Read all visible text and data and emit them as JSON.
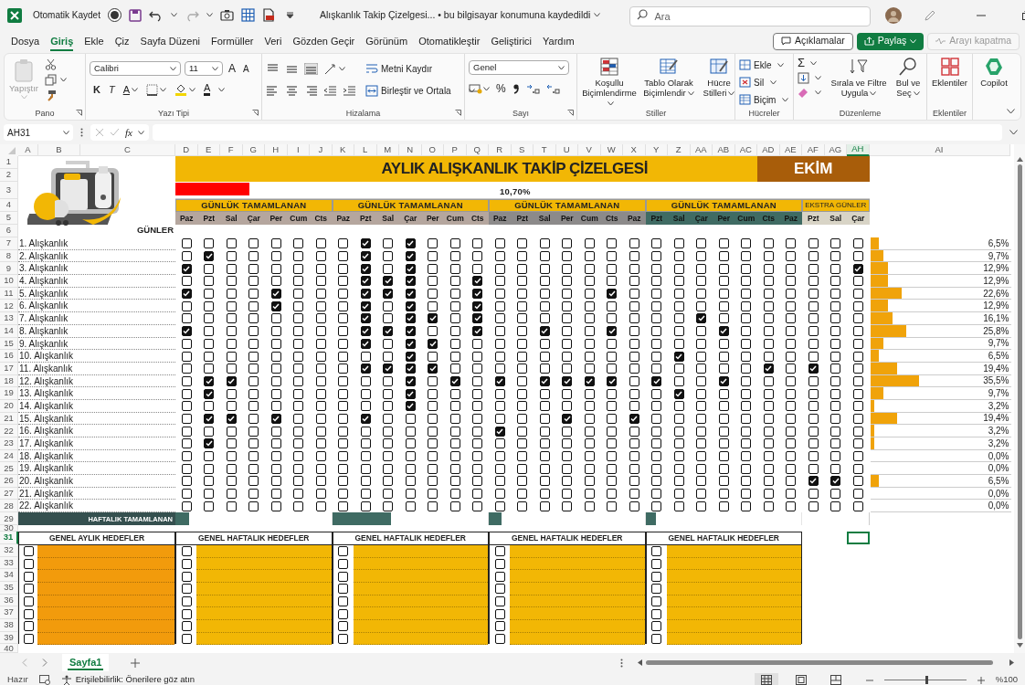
{
  "title_bar": {
    "autosave_label": "Otomatik Kaydet",
    "autosave_on": false,
    "document_title": "Alışkanlık Takip Çizelgesi...  •  bu bilgisayar konumuna kaydedildi",
    "search_placeholder": "Ara"
  },
  "menu_tabs": [
    {
      "label": "Dosya",
      "selected": false
    },
    {
      "label": "Giriş",
      "selected": true
    },
    {
      "label": "Ekle",
      "selected": false
    },
    {
      "label": "Çiz",
      "selected": false
    },
    {
      "label": "Sayfa Düzeni",
      "selected": false
    },
    {
      "label": "Formüller",
      "selected": false
    },
    {
      "label": "Veri",
      "selected": false
    },
    {
      "label": "Gözden Geçir",
      "selected": false
    },
    {
      "label": "Görünüm",
      "selected": false
    },
    {
      "label": "Otomatikleştir",
      "selected": false
    },
    {
      "label": "Geliştirici",
      "selected": false
    },
    {
      "label": "Yardım",
      "selected": false
    }
  ],
  "menu_buttons": [
    {
      "kind": "comments",
      "label": "Açıklamalar"
    },
    {
      "kind": "share",
      "label": "Paylaş"
    },
    {
      "kind": "call",
      "label": "Arayı kapatma",
      "disabled": true
    }
  ],
  "ribbon": [
    {
      "kind": "clipboard",
      "label": "Pano",
      "buttons": [
        "Yapıştır"
      ]
    },
    {
      "kind": "font",
      "label": "Yazı Tipi",
      "font": "Calibri",
      "size": "11",
      "grow": "A",
      "shrink": "A",
      "bold": "K",
      "italic": "T",
      "underline": "A",
      "color_letter": "A"
    },
    {
      "kind": "alignment",
      "label": "Hizalama",
      "buttons": [
        "Metni Kaydır",
        "Birleştir ve Ortala"
      ]
    },
    {
      "kind": "number",
      "label": "Sayı",
      "format": "Genel",
      "percent": "%"
    },
    {
      "kind": "styles",
      "label": "Stiller",
      "buttons": [
        "Koşullu Biçimlendirme",
        "Tablo Olarak Biçimlendir",
        "Hücre Stilleri"
      ]
    },
    {
      "kind": "cells",
      "label": "Hücreler",
      "buttons": [
        "Ekle",
        "Sil",
        "Biçim"
      ]
    },
    {
      "kind": "editing",
      "label": "Düzenleme",
      "sum": "Σ",
      "buttons": [
        "Sırala ve Filtre Uygula",
        "Bul ve Seç"
      ]
    },
    {
      "kind": "addins",
      "label": "Eklentiler",
      "buttons": [
        "Eklentiler"
      ]
    },
    {
      "kind": "copilot",
      "buttons": [
        "Copilot"
      ]
    }
  ],
  "formula_bar": {
    "name_box": "AH31",
    "fx": "fx"
  },
  "column_headers": [
    {
      "label": "A",
      "selected": false
    },
    {
      "label": "B",
      "selected": false
    },
    {
      "label": "C",
      "selected": false
    },
    {
      "label": "D",
      "selected": false
    },
    {
      "label": "E",
      "selected": false
    },
    {
      "label": "F",
      "selected": false
    },
    {
      "label": "G",
      "selected": false
    },
    {
      "label": "H",
      "selected": false
    },
    {
      "label": "I",
      "selected": false
    },
    {
      "label": "J",
      "selected": false
    },
    {
      "label": "K",
      "selected": false
    },
    {
      "label": "L",
      "selected": false
    },
    {
      "label": "M",
      "selected": false
    },
    {
      "label": "N",
      "selected": false
    },
    {
      "label": "O",
      "selected": false
    },
    {
      "label": "P",
      "selected": false
    },
    {
      "label": "Q",
      "selected": false
    },
    {
      "label": "R",
      "selected": false
    },
    {
      "label": "S",
      "selected": false
    },
    {
      "label": "T",
      "selected": false
    },
    {
      "label": "U",
      "selected": false
    },
    {
      "label": "V",
      "selected": false
    },
    {
      "label": "W",
      "selected": false
    },
    {
      "label": "X",
      "selected": false
    },
    {
      "label": "Y",
      "selected": false
    },
    {
      "label": "Z",
      "selected": false
    },
    {
      "label": "AA",
      "selected": false
    },
    {
      "label": "AB",
      "selected": false
    },
    {
      "label": "AC",
      "selected": false
    },
    {
      "label": "AD",
      "selected": false
    },
    {
      "label": "AE",
      "selected": false
    },
    {
      "label": "AF",
      "selected": false
    },
    {
      "label": "AG",
      "selected": false
    },
    {
      "label": "AH",
      "selected": true
    },
    {
      "label": "AI",
      "selected": false
    }
  ],
  "row_headers": [
    {
      "label": "1",
      "selected": false
    },
    {
      "label": "2",
      "selected": false
    },
    {
      "label": "3",
      "selected": false
    },
    {
      "label": "4",
      "selected": false
    },
    {
      "label": "5",
      "selected": false
    },
    {
      "label": "6",
      "selected": false
    },
    {
      "label": "7",
      "selected": false
    },
    {
      "label": "8",
      "selected": false
    },
    {
      "label": "9",
      "selected": false
    },
    {
      "label": "10",
      "selected": false
    },
    {
      "label": "11",
      "selected": false
    },
    {
      "label": "12",
      "selected": false
    },
    {
      "label": "13",
      "selected": false
    },
    {
      "label": "14",
      "selected": false
    },
    {
      "label": "15",
      "selected": false
    },
    {
      "label": "16",
      "selected": false
    },
    {
      "label": "17",
      "selected": false
    },
    {
      "label": "18",
      "selected": false
    },
    {
      "label": "19",
      "selected": false
    },
    {
      "label": "20",
      "selected": false
    },
    {
      "label": "21",
      "selected": false
    },
    {
      "label": "22",
      "selected": false
    },
    {
      "label": "23",
      "selected": false
    },
    {
      "label": "24",
      "selected": false
    },
    {
      "label": "25",
      "selected": false
    },
    {
      "label": "26",
      "selected": false
    },
    {
      "label": "27",
      "selected": false
    },
    {
      "label": "28",
      "selected": false
    },
    {
      "label": "29",
      "selected": false
    },
    {
      "label": "30",
      "selected": false
    },
    {
      "label": "31",
      "selected": true
    },
    {
      "label": "32",
      "selected": false
    },
    {
      "label": "33",
      "selected": false
    },
    {
      "label": "34",
      "selected": false
    },
    {
      "label": "35",
      "selected": false
    },
    {
      "label": "36",
      "selected": false
    },
    {
      "label": "37",
      "selected": false
    },
    {
      "label": "38",
      "selected": false
    },
    {
      "label": "39",
      "selected": false
    },
    {
      "label": "40",
      "selected": false
    }
  ],
  "tracker": {
    "title": "AYLIK ALIŞKANLIK TAKİP ÇİZELGESİ",
    "month": "EKİM",
    "progress": {
      "level": 0.107,
      "reading": "10,70%"
    },
    "days_label": "GÜNLER",
    "weekly_label": "HAFTALIK TAMAMLANAN",
    "weeks": [
      {
        "label": "GÜNLÜK TAMAMLANAN",
        "color": "#b5a69e",
        "days": [
          "Paz",
          "Pzt",
          "Sal",
          "Çar",
          "Per",
          "Cum",
          "Cts"
        ],
        "level": 0.09
      },
      {
        "label": "GÜNLÜK TAMAMLANAN",
        "color": "#b5a69e",
        "days": [
          "Paz",
          "Pzt",
          "Sal",
          "Çar",
          "Per",
          "Cum",
          "Cts"
        ],
        "level": 0.38
      },
      {
        "label": "GÜNLÜK TAMAMLANAN",
        "color": "#8c8a8a",
        "days": [
          "Paz",
          "Pzt",
          "Sal",
          "Per",
          "Cum",
          "Cts",
          "Paz"
        ],
        "level": 0.08
      },
      {
        "label": "GÜNLÜK TAMAMLANAN",
        "color": "#3f6b63",
        "days": [
          "Pzt",
          "Sal",
          "Çar",
          "Per",
          "Cum",
          "Cts",
          "Paz"
        ],
        "level": 0.07
      },
      {
        "label": "EKSTRA GÜNLER",
        "color": "#d8d4c6",
        "days": [
          "Pzt",
          "Sal",
          "Çar"
        ]
      }
    ],
    "habits": [
      {
        "name": "1. Alışkanlık",
        "level": 0.065,
        "reading": "6,5%",
        "checks": [
          [
            false,
            false,
            false,
            false,
            false,
            false,
            false
          ],
          [
            false,
            true,
            false,
            true,
            false,
            false,
            false
          ],
          [
            false,
            false,
            false,
            false,
            false,
            false,
            false
          ],
          [
            false,
            false,
            false,
            false,
            false,
            false,
            false
          ],
          [
            false,
            false,
            false
          ]
        ]
      },
      {
        "name": "2. Alışkanlık",
        "level": 0.097,
        "reading": "9,7%",
        "checks": [
          [
            false,
            true,
            false,
            false,
            false,
            false,
            false
          ],
          [
            false,
            true,
            false,
            true,
            false,
            false,
            false
          ],
          [
            false,
            false,
            false,
            false,
            false,
            false,
            false
          ],
          [
            false,
            false,
            false,
            false,
            false,
            false,
            false
          ],
          [
            false,
            false,
            false
          ]
        ]
      },
      {
        "name": "3. Alışkanlık",
        "level": 0.129,
        "reading": "12,9%",
        "checks": [
          [
            true,
            false,
            false,
            false,
            false,
            false,
            false
          ],
          [
            false,
            true,
            false,
            true,
            false,
            false,
            false
          ],
          [
            false,
            false,
            false,
            false,
            false,
            false,
            false
          ],
          [
            false,
            false,
            false,
            false,
            false,
            false,
            false
          ],
          [
            false,
            false,
            true
          ]
        ]
      },
      {
        "name": "4. Alışkanlık",
        "level": 0.129,
        "reading": "12,9%",
        "checks": [
          [
            false,
            false,
            false,
            false,
            false,
            false,
            false
          ],
          [
            false,
            true,
            true,
            true,
            false,
            false,
            true
          ],
          [
            false,
            false,
            false,
            false,
            false,
            false,
            false
          ],
          [
            false,
            false,
            false,
            false,
            false,
            false,
            false
          ],
          [
            false,
            false,
            false
          ]
        ]
      },
      {
        "name": "5. Alışkanlık",
        "level": 0.226,
        "reading": "22,6%",
        "checks": [
          [
            true,
            false,
            false,
            false,
            true,
            false,
            false
          ],
          [
            false,
            true,
            true,
            true,
            false,
            false,
            true
          ],
          [
            false,
            false,
            false,
            false,
            false,
            true,
            false
          ],
          [
            false,
            false,
            false,
            false,
            false,
            false,
            false
          ],
          [
            false,
            false,
            false
          ]
        ]
      },
      {
        "name": "6. Alışkanlık",
        "level": 0.129,
        "reading": "12,9%",
        "checks": [
          [
            false,
            false,
            false,
            false,
            true,
            false,
            false
          ],
          [
            false,
            true,
            false,
            true,
            false,
            false,
            true
          ],
          [
            false,
            false,
            false,
            false,
            false,
            false,
            false
          ],
          [
            false,
            false,
            false,
            false,
            false,
            false,
            false
          ],
          [
            false,
            false,
            false
          ]
        ]
      },
      {
        "name": "7. Alışkanlık",
        "level": 0.161,
        "reading": "16,1%",
        "checks": [
          [
            false,
            false,
            false,
            false,
            false,
            false,
            false
          ],
          [
            false,
            true,
            false,
            true,
            true,
            false,
            true
          ],
          [
            false,
            false,
            false,
            false,
            false,
            false,
            false
          ],
          [
            false,
            false,
            true,
            false,
            false,
            false,
            false
          ],
          [
            false,
            false,
            false
          ]
        ]
      },
      {
        "name": "8. Alışkanlık",
        "level": 0.258,
        "reading": "25,8%",
        "checks": [
          [
            true,
            false,
            false,
            false,
            false,
            false,
            false
          ],
          [
            false,
            true,
            true,
            true,
            false,
            false,
            true
          ],
          [
            false,
            false,
            true,
            false,
            false,
            true,
            false
          ],
          [
            false,
            false,
            false,
            true,
            false,
            false,
            false
          ],
          [
            false,
            false,
            false
          ]
        ]
      },
      {
        "name": "9. Alışkanlık",
        "level": 0.097,
        "reading": "9,7%",
        "checks": [
          [
            false,
            false,
            false,
            false,
            false,
            false,
            false
          ],
          [
            false,
            true,
            false,
            true,
            true,
            false,
            false
          ],
          [
            false,
            false,
            false,
            false,
            false,
            false,
            false
          ],
          [
            false,
            false,
            false,
            false,
            false,
            false,
            false
          ],
          [
            false,
            false,
            false
          ]
        ]
      },
      {
        "name": "10. Alışkanlık",
        "level": 0.065,
        "reading": "6,5%",
        "checks": [
          [
            false,
            false,
            false,
            false,
            false,
            false,
            false
          ],
          [
            false,
            false,
            false,
            true,
            false,
            false,
            false
          ],
          [
            false,
            false,
            false,
            false,
            false,
            false,
            false
          ],
          [
            false,
            true,
            false,
            false,
            false,
            false,
            false
          ],
          [
            false,
            false,
            false
          ]
        ]
      },
      {
        "name": "11. Alışkanlık",
        "level": 0.194,
        "reading": "19,4%",
        "checks": [
          [
            false,
            false,
            false,
            false,
            false,
            false,
            false
          ],
          [
            false,
            true,
            true,
            true,
            true,
            false,
            false
          ],
          [
            false,
            false,
            false,
            false,
            false,
            false,
            false
          ],
          [
            false,
            false,
            false,
            false,
            false,
            true,
            false
          ],
          [
            true,
            false,
            false
          ]
        ]
      },
      {
        "name": "12. Alışkanlık",
        "level": 0.355,
        "reading": "35,5%",
        "checks": [
          [
            false,
            true,
            true,
            false,
            false,
            false,
            false
          ],
          [
            false,
            false,
            false,
            true,
            false,
            true,
            false
          ],
          [
            true,
            false,
            true,
            true,
            true,
            true,
            false
          ],
          [
            true,
            false,
            false,
            true,
            false,
            false,
            false
          ],
          [
            false,
            false,
            false
          ]
        ]
      },
      {
        "name": "13. Alışkanlık",
        "level": 0.097,
        "reading": "9,7%",
        "checks": [
          [
            false,
            true,
            false,
            false,
            false,
            false,
            false
          ],
          [
            false,
            false,
            false,
            true,
            false,
            false,
            false
          ],
          [
            false,
            false,
            false,
            false,
            false,
            false,
            false
          ],
          [
            false,
            true,
            false,
            false,
            false,
            false,
            false
          ],
          [
            false,
            false,
            false
          ]
        ]
      },
      {
        "name": "14. Alışkanlık",
        "level": 0.032,
        "reading": "3,2%",
        "checks": [
          [
            false,
            false,
            false,
            false,
            false,
            false,
            false
          ],
          [
            false,
            false,
            false,
            true,
            false,
            false,
            false
          ],
          [
            false,
            false,
            false,
            false,
            false,
            false,
            false
          ],
          [
            false,
            false,
            false,
            false,
            false,
            false,
            false
          ],
          [
            false,
            false,
            false
          ]
        ]
      },
      {
        "name": "15. Alışkanlık",
        "level": 0.194,
        "reading": "19,4%",
        "checks": [
          [
            false,
            true,
            true,
            false,
            true,
            false,
            false
          ],
          [
            false,
            true,
            false,
            false,
            false,
            false,
            false
          ],
          [
            false,
            false,
            false,
            true,
            false,
            false,
            true
          ],
          [
            false,
            false,
            false,
            false,
            false,
            false,
            false
          ],
          [
            false,
            false,
            false
          ]
        ]
      },
      {
        "name": "16. Alışkanlık",
        "level": 0.032,
        "reading": "3,2%",
        "checks": [
          [
            false,
            false,
            false,
            false,
            false,
            false,
            false
          ],
          [
            false,
            false,
            false,
            false,
            false,
            false,
            false
          ],
          [
            true,
            false,
            false,
            false,
            false,
            false,
            false
          ],
          [
            false,
            false,
            false,
            false,
            false,
            false,
            false
          ],
          [
            false,
            false,
            false
          ]
        ]
      },
      {
        "name": "17. Alışkanlık",
        "level": 0.032,
        "reading": "3,2%",
        "checks": [
          [
            false,
            true,
            false,
            false,
            false,
            false,
            false
          ],
          [
            false,
            false,
            false,
            false,
            false,
            false,
            false
          ],
          [
            false,
            false,
            false,
            false,
            false,
            false,
            false
          ],
          [
            false,
            false,
            false,
            false,
            false,
            false,
            false
          ],
          [
            false,
            false,
            false
          ]
        ]
      },
      {
        "name": "18. Alışkanlık",
        "reading": "0,0%",
        "checks": [
          [
            false,
            false,
            false,
            false,
            false,
            false,
            false
          ],
          [
            false,
            false,
            false,
            false,
            false,
            false,
            false
          ],
          [
            false,
            false,
            false,
            false,
            false,
            false,
            false
          ],
          [
            false,
            false,
            false,
            false,
            false,
            false,
            false
          ],
          [
            false,
            false,
            false
          ]
        ]
      },
      {
        "name": "19. Alışkanlık",
        "reading": "0,0%",
        "checks": [
          [
            false,
            false,
            false,
            false,
            false,
            false,
            false
          ],
          [
            false,
            false,
            false,
            false,
            false,
            false,
            false
          ],
          [
            false,
            false,
            false,
            false,
            false,
            false,
            false
          ],
          [
            false,
            false,
            false,
            false,
            false,
            false,
            false
          ],
          [
            false,
            false,
            false
          ]
        ]
      },
      {
        "name": "20. Alışkanlık",
        "level": 0.065,
        "reading": "6,5%",
        "checks": [
          [
            false,
            false,
            false,
            false,
            false,
            false,
            false
          ],
          [
            false,
            false,
            false,
            false,
            false,
            false,
            false
          ],
          [
            false,
            false,
            false,
            false,
            false,
            false,
            false
          ],
          [
            false,
            false,
            false,
            false,
            false,
            false,
            false
          ],
          [
            true,
            true,
            false
          ]
        ]
      },
      {
        "name": "21. Alışkanlık",
        "reading": "0,0%",
        "checks": [
          [
            false,
            false,
            false,
            false,
            false,
            false,
            false
          ],
          [
            false,
            false,
            false,
            false,
            false,
            false,
            false
          ],
          [
            false,
            false,
            false,
            false,
            false,
            false,
            false
          ],
          [
            false,
            false,
            false,
            false,
            false,
            false,
            false
          ],
          [
            false,
            false,
            false
          ]
        ]
      },
      {
        "name": "22. Alışkanlık",
        "reading": "0,0%",
        "checks": [
          [
            false,
            false,
            false,
            false,
            false,
            false,
            false
          ],
          [
            false,
            false,
            false,
            false,
            false,
            false,
            false
          ],
          [
            false,
            false,
            false,
            false,
            false,
            false,
            false
          ],
          [
            false,
            false,
            false,
            false,
            false,
            false,
            false
          ],
          [
            false,
            false,
            false
          ]
        ]
      }
    ],
    "goals": [
      {
        "title": "GENEL AYLIK HEDEFLER",
        "color": "#f29b0c",
        "items": [
          {
            "checked": false
          },
          {
            "checked": false
          },
          {
            "checked": false
          },
          {
            "checked": false
          },
          {
            "checked": false
          },
          {
            "checked": false
          },
          {
            "checked": false
          },
          {
            "checked": false
          }
        ]
      },
      {
        "title": "GENEL HAFTALIK HEDEFLER",
        "color": "#f2b705",
        "items": [
          {
            "checked": false
          },
          {
            "checked": false
          },
          {
            "checked": false
          },
          {
            "checked": false
          },
          {
            "checked": false
          },
          {
            "checked": false
          },
          {
            "checked": false
          },
          {
            "checked": false
          }
        ]
      },
      {
        "title": "GENEL HAFTALIK HEDEFLER",
        "color": "#f2b705",
        "items": [
          {
            "checked": false
          },
          {
            "checked": false
          },
          {
            "checked": false
          },
          {
            "checked": false
          },
          {
            "checked": false
          },
          {
            "checked": false
          },
          {
            "checked": false
          },
          {
            "checked": false
          }
        ]
      },
      {
        "title": "GENEL HAFTALIK HEDEFLER",
        "color": "#f2b705",
        "items": [
          {
            "checked": false
          },
          {
            "checked": false
          },
          {
            "checked": false
          },
          {
            "checked": false
          },
          {
            "checked": false
          },
          {
            "checked": false
          },
          {
            "checked": false
          },
          {
            "checked": false
          }
        ]
      },
      {
        "title": "GENEL HAFTALIK HEDEFLER",
        "color": "#f2b705",
        "items": [
          {
            "checked": false
          },
          {
            "checked": false
          },
          {
            "checked": false
          },
          {
            "checked": false
          },
          {
            "checked": false
          },
          {
            "checked": false
          },
          {
            "checked": false
          },
          {
            "checked": false
          }
        ]
      }
    ]
  },
  "sheet_tabs": [
    {
      "label": "Sayfa1",
      "selected": true
    }
  ],
  "status_bar": {
    "ready": "Hazır",
    "accessibility": "Erişilebilirlik: Önerilere göz atın",
    "zoom": "%100",
    "zoom_slider": {
      "level": 0.5
    },
    "views": [
      {
        "kind": "normal",
        "selected": true
      },
      {
        "kind": "page_layout",
        "selected": false
      },
      {
        "kind": "page_break",
        "selected": false
      }
    ]
  }
}
